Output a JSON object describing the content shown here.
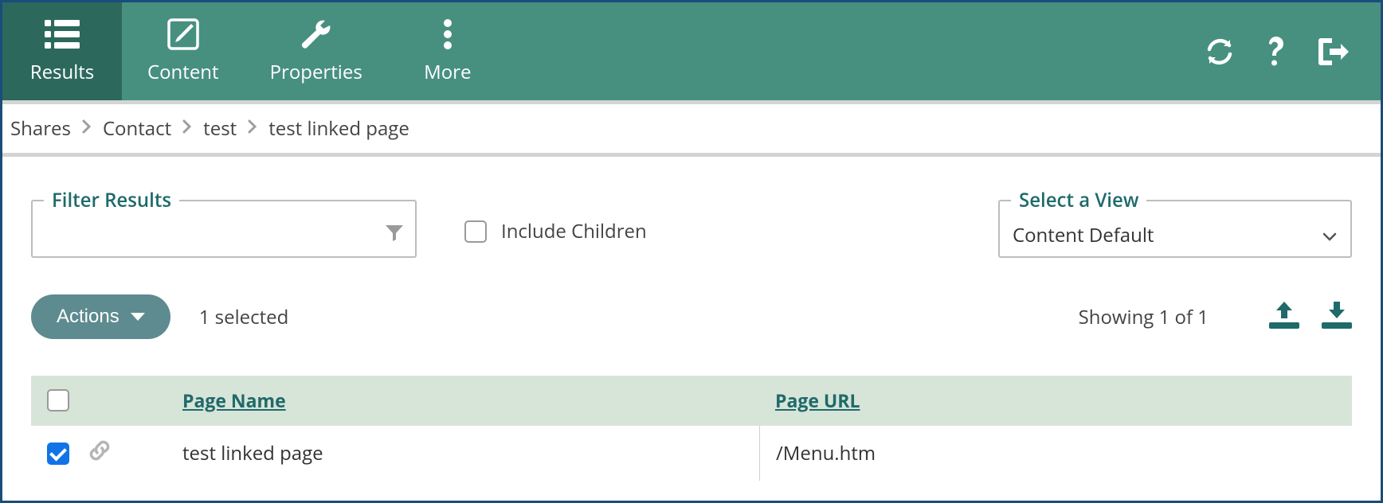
{
  "toolbar": {
    "tabs": {
      "results": "Results",
      "content": "Content",
      "properties": "Properties",
      "more": "More"
    }
  },
  "breadcrumbs": {
    "items": [
      "Shares",
      "Contact",
      "test",
      "test linked page"
    ]
  },
  "filter": {
    "legend": "Filter Results"
  },
  "include_children": {
    "label": "Include Children",
    "checked": false
  },
  "view": {
    "legend": "Select a View",
    "value": "Content Default"
  },
  "actions": {
    "label": "Actions",
    "selected": "1 selected",
    "showing": "Showing 1 of 1"
  },
  "table": {
    "columns": {
      "name": "Page Name",
      "url": "Page URL"
    },
    "rows": [
      {
        "checked": true,
        "name": "test linked page",
        "url": "/Menu.htm"
      }
    ]
  }
}
